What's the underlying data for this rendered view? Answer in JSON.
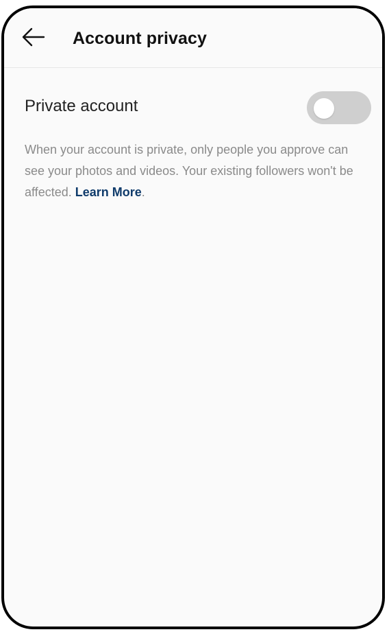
{
  "header": {
    "title": "Account privacy",
    "back_icon": "arrow-left-icon"
  },
  "settings": {
    "private_account": {
      "label": "Private account",
      "enabled": false
    },
    "description": {
      "text": "When your account is private, only people you approve can see your photos and videos. Your existing followers won't be affected.",
      "link_text": "Learn More",
      "suffix": "."
    }
  },
  "colors": {
    "toggle_off": "#cfcfcf",
    "link": "#0f3b6b",
    "description": "#8a8a8a"
  }
}
